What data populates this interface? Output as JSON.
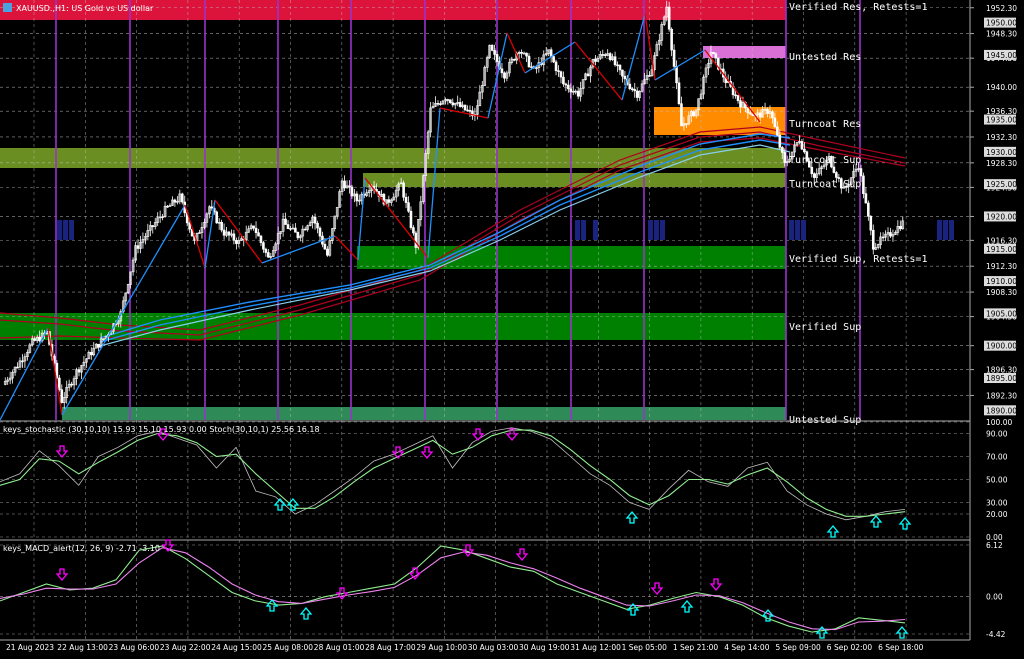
{
  "window": {
    "title": "XAUUSD.,H1: US Gold vs US dollar",
    "symbol_icon": "chart-menu-icon"
  },
  "colors": {
    "background": "#000000",
    "grid": "#c0c0c0",
    "candle_up": "#ffffff",
    "candle_down": "#ffffff",
    "fractal_line": "#e00000",
    "fast_ma": "#1e90ff",
    "slow_ma": "#b00020",
    "zone_verified_res": "#dc143c",
    "zone_untested_res": "#da70d6",
    "zone_turncoat_res": "#ff8c00",
    "zone_turncoat_sup": "#6b8e23",
    "zone_verified_sup": "#008000",
    "zone_untested_sup": "#2e8b57",
    "session_line": "#9932cc",
    "stoch_main": "#c0c0c0",
    "stoch_signal": "#90ee90",
    "macd_main": "#90ee90",
    "macd_signal": "#ee82ee",
    "arrow_down": "#ff00ff",
    "arrow_up": "#00ffff"
  },
  "zones": [
    {
      "label": "Verified Res, Retests=1",
      "kind": "verified-res"
    },
    {
      "label": "Untested Res",
      "kind": "untested-res"
    },
    {
      "label": "Turncoat Res",
      "kind": "turncoat-res"
    },
    {
      "label": "Turncoat Sup",
      "kind": "turncoat-sup"
    },
    {
      "label": "Turncoat Sup",
      "kind": "turncoat-sup-2"
    },
    {
      "label": "Verified Sup, Retests=1",
      "kind": "verified-sup-1"
    },
    {
      "label": "Verified Sup",
      "kind": "verified-sup"
    },
    {
      "label": "Untested Sup",
      "kind": "untested-sup"
    }
  ],
  "price_axis": {
    "ticks": [
      "1952.30",
      "1948.30",
      "1944.50",
      "1940.00",
      "1936.30",
      "1932.30",
      "1928.30",
      "1924.50",
      "1920.00",
      "1916.30",
      "1912.30",
      "1908.30",
      "1904.50",
      "1900.00",
      "1896.30",
      "1892.30"
    ],
    "highlighted": [
      "1950.00",
      "1945.00",
      "1935.00",
      "1930.00",
      "1925.00",
      "1920.00",
      "1915.00",
      "1910.00",
      "1905.00",
      "1900.00",
      "1895.00",
      "1890.00"
    ]
  },
  "stochastic": {
    "title": "keys_stochastic (30,10,10) 15.93 15.10 15.93 0.00 Stoch(30,10,1) 25.56 16.18",
    "ticks": [
      "100.00",
      "90.00",
      "70.00",
      "50.00",
      "30.00",
      "20.00",
      "0.00"
    ]
  },
  "macd": {
    "title": "keys_MACD_alert(12, 26, 9) -2.71 -3.10",
    "ticks": [
      "6.12",
      "0.00",
      "-4.42"
    ]
  },
  "time_axis": {
    "labels": [
      "21 Aug 2023",
      "22 Aug 13:00",
      "23 Aug 06:00",
      "23 Aug 22:00",
      "24 Aug 15:00",
      "25 Aug 08:00",
      "28 Aug 01:00",
      "28 Aug 17:00",
      "29 Aug 10:00",
      "30 Aug 03:00",
      "30 Aug 19:00",
      "31 Aug 12:00",
      "1 Sep 05:00",
      "1 Sep 21:00",
      "4 Sep 14:00",
      "5 Sep 09:00",
      "6 Sep 02:00",
      "6 Sep 18:00"
    ]
  },
  "chart_data": [
    {
      "type": "candlestick",
      "title": "XAUUSD.,H1: US Gold vs US dollar",
      "x": [
        "21 Aug 2023",
        "22 Aug 13:00",
        "23 Aug 06:00",
        "23 Aug 22:00",
        "24 Aug 15:00",
        "25 Aug 08:00",
        "28 Aug 01:00",
        "28 Aug 17:00",
        "29 Aug 10:00",
        "30 Aug 03:00",
        "30 Aug 19:00",
        "31 Aug 12:00",
        "1 Sep 05:00",
        "1 Sep 21:00",
        "4 Sep 14:00",
        "5 Sep 09:00",
        "6 Sep 02:00",
        "6 Sep 18:00"
      ],
      "price_path": [
        1894.0,
        1897.0,
        1900.5,
        1902.0,
        1891.5,
        1896.0,
        1899.0,
        1901.5,
        1905.0,
        1915.0,
        1918.0,
        1921.0,
        1923.0,
        1916.0,
        1921.5,
        1917.5,
        1916.0,
        1918.5,
        1913.5,
        1919.0,
        1917.0,
        1920.0,
        1914.0,
        1925.5,
        1922.5,
        1925.0,
        1922.0,
        1925.0,
        1915.5,
        1936.5,
        1938.5,
        1937.0,
        1935.5,
        1946.0,
        1942.0,
        1946.0,
        1942.5,
        1945.5,
        1940.5,
        1939.0,
        1944.0,
        1945.5,
        1941.5,
        1939.0,
        1943.0,
        1952.5,
        1934.0,
        1936.5,
        1945.5,
        1941.0,
        1937.5,
        1935.5,
        1936.5,
        1928.0,
        1932.0,
        1926.0,
        1929.0,
        1924.0,
        1928.0,
        1915.5,
        1917.0,
        1919.0
      ],
      "ylim": [
        1888.5,
        1953.5
      ],
      "grid": true
    },
    {
      "type": "line",
      "title": "keys_stochastic (30,10,10) 15.93 15.10 15.93 0.00 Stoch(30,10,1) 25.56 16.18",
      "series": [
        {
          "name": "keys_stochastic",
          "values": [
            48,
            55,
            75,
            62,
            45,
            70,
            78,
            88,
            92,
            86,
            80,
            60,
            78,
            40,
            35,
            20,
            28,
            40,
            52,
            66,
            72,
            80,
            88,
            60,
            82,
            92,
            95,
            92,
            85,
            70,
            55,
            45,
            30,
            24,
            42,
            58,
            48,
            44,
            60,
            65,
            40,
            28,
            20,
            15,
            18,
            22,
            24
          ]
        },
        {
          "name": "Stoch",
          "values": [
            45,
            50,
            68,
            66,
            55,
            65,
            74,
            84,
            90,
            88,
            82,
            70,
            72,
            55,
            40,
            25,
            25,
            35,
            48,
            60,
            68,
            76,
            84,
            72,
            78,
            88,
            93,
            93,
            88,
            76,
            62,
            50,
            36,
            28,
            36,
            50,
            50,
            46,
            54,
            60,
            48,
            34,
            24,
            18,
            18,
            20,
            22
          ]
        }
      ],
      "ylim": [
        0,
        100
      ]
    },
    {
      "type": "line",
      "title": "keys_MACD_alert(12, 26, 9) -2.71 -3.10",
      "series": [
        {
          "name": "keys_MACD_alert",
          "values": [
            -0.5,
            0.5,
            1.5,
            0.8,
            1.0,
            2.0,
            5.5,
            6.0,
            4.5,
            2.5,
            0.5,
            -0.5,
            -1.0,
            -0.8,
            0.0,
            0.5,
            1.0,
            1.5,
            3.5,
            6.0,
            5.5,
            4.5,
            3.5,
            3.0,
            1.5,
            0.5,
            -0.5,
            -1.5,
            -1.0,
            -0.2,
            0.5,
            0.0,
            -1.0,
            -2.5,
            -3.5,
            -4.2,
            -3.8,
            -2.5,
            -2.8,
            -3.1
          ]
        },
        {
          "name": "signal",
          "values": [
            -0.2,
            0.3,
            1.0,
            0.9,
            0.9,
            1.5,
            4.0,
            5.8,
            5.2,
            3.5,
            1.5,
            0.2,
            -0.6,
            -0.8,
            -0.3,
            0.2,
            0.6,
            1.1,
            2.6,
            4.6,
            5.3,
            4.9,
            4.0,
            3.3,
            2.2,
            1.0,
            0.0,
            -1.0,
            -1.1,
            -0.5,
            0.2,
            0.1,
            -0.7,
            -1.9,
            -3.0,
            -3.8,
            -3.9,
            -3.0,
            -2.9,
            -2.7
          ]
        }
      ],
      "ylim": [
        -4.42,
        6.12
      ]
    }
  ]
}
